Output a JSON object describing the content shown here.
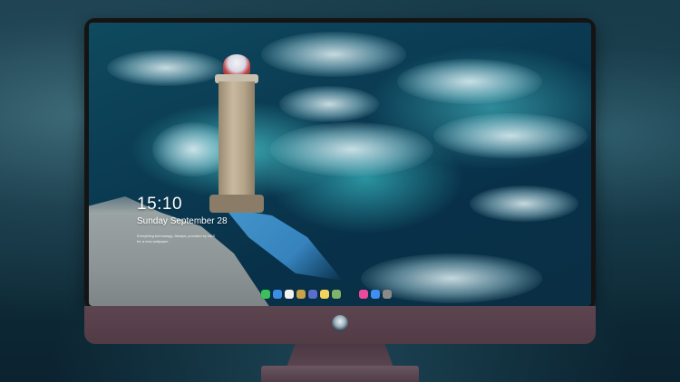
{
  "lock_screen": {
    "time": "15:10",
    "date": "Sunday September 28",
    "note_line_1": "Everything technology; Always; provided by NAS",
    "note_line_2": "for a new wallpaper"
  },
  "dock": {
    "apps": [
      {
        "name": "messages-icon",
        "color": "#3ac25a"
      },
      {
        "name": "finder-icon",
        "color": "#3a8ee6"
      },
      {
        "name": "clock-icon",
        "color": "#f2f2f2"
      },
      {
        "name": "preview-icon",
        "color": "#c9a34a"
      },
      {
        "name": "imovie-icon",
        "color": "#5b6ec8"
      },
      {
        "name": "notes-icon",
        "color": "#f4d35e"
      },
      {
        "name": "photos-icon",
        "color": "#7fb36a"
      },
      {
        "name": "gap",
        "color": ""
      },
      {
        "name": "music-icon",
        "color": "#e84a9c"
      },
      {
        "name": "app-store-icon",
        "color": "#3f8ef0"
      },
      {
        "name": "camera-icon",
        "color": "#8a8a8a"
      }
    ]
  },
  "colors": {
    "bezel": "#141414",
    "chin": "#5d4550",
    "background": "#173846"
  }
}
